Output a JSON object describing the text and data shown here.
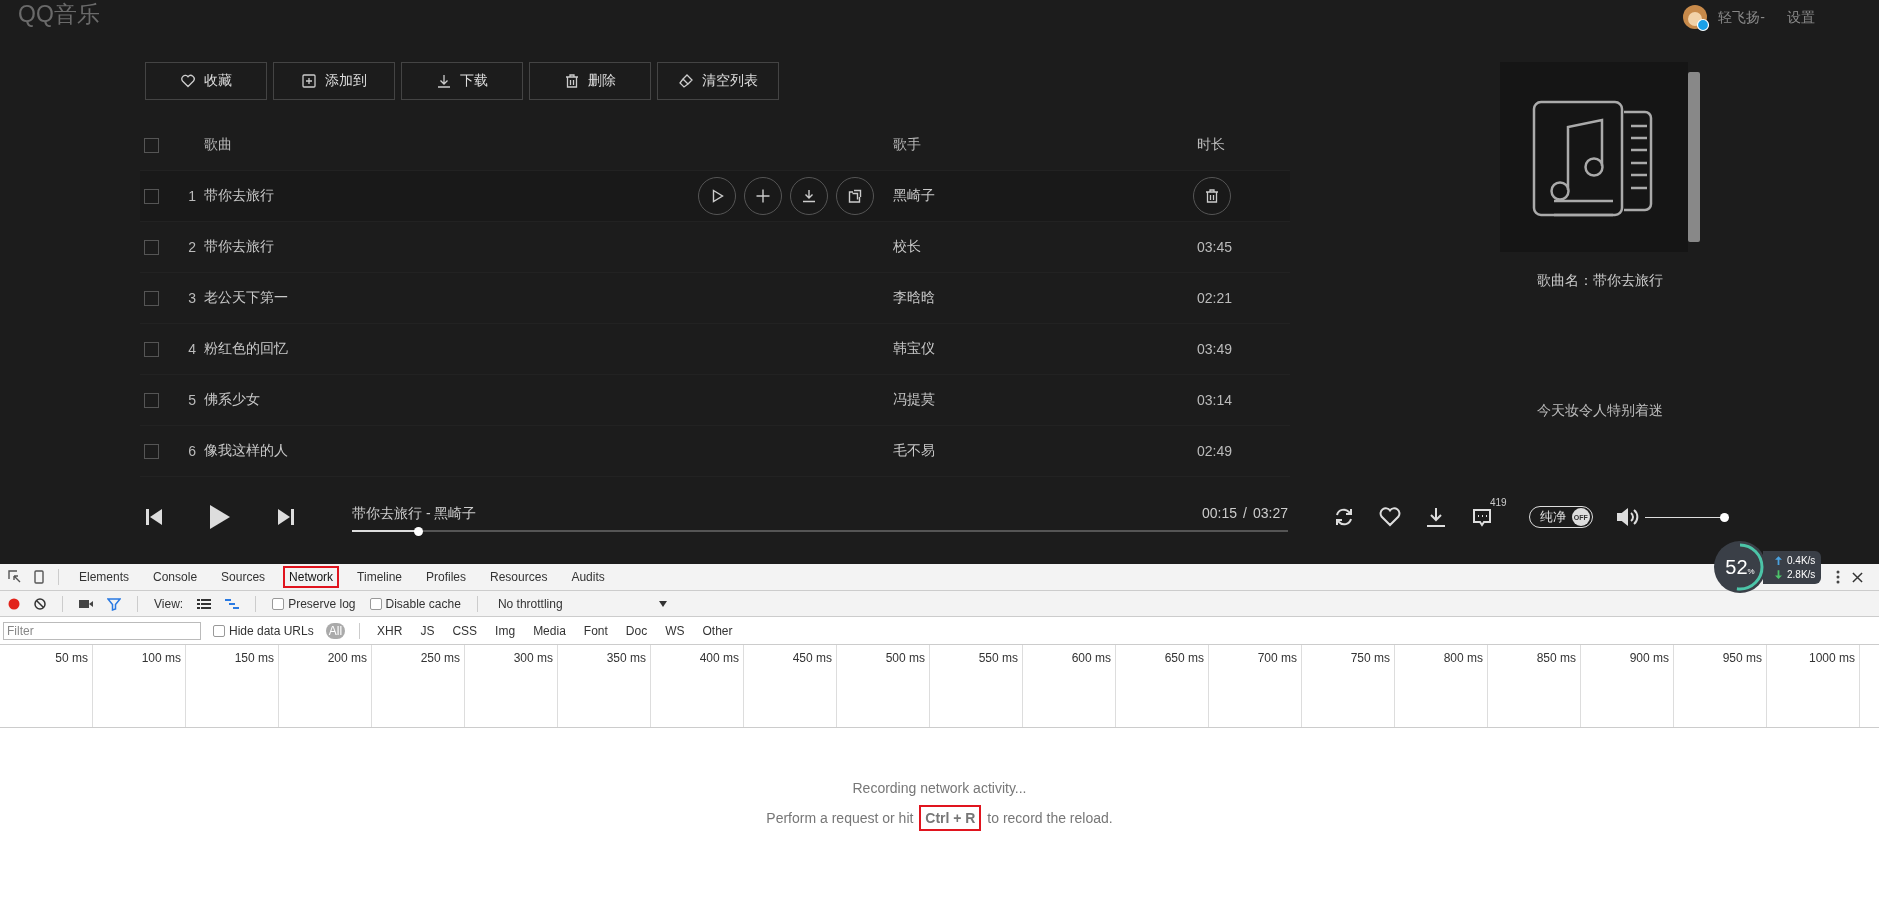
{
  "app": {
    "logo": "QQ音乐",
    "user": {
      "name": "轻飞扬-",
      "settings": "设置"
    },
    "toolbar": [
      {
        "label": "收藏"
      },
      {
        "label": "添加到"
      },
      {
        "label": "下载"
      },
      {
        "label": "删除"
      },
      {
        "label": "清空列表"
      }
    ],
    "song_table": {
      "columns": [
        "歌曲",
        "歌手",
        "时长"
      ],
      "select_all_checked": false,
      "rows": [
        {
          "number": "1",
          "title": "带你去旅行",
          "singer": "黑崎子",
          "hovered": true,
          "checked": false
        },
        {
          "number": "2",
          "title": "带你去旅行",
          "singer": "校长",
          "duration": "03:45",
          "hovered": false,
          "checked": false
        },
        {
          "number": "3",
          "title": "老公天下第一",
          "singer": "李晗晗",
          "duration": "02:21",
          "hovered": false,
          "checked": false
        },
        {
          "number": "4",
          "title": "粉红色的回忆",
          "singer": "韩宝仪",
          "duration": "03:49",
          "hovered": false,
          "checked": false
        },
        {
          "number": "5",
          "title": "佛系少女",
          "singer": "冯提莫",
          "duration": "03:14",
          "hovered": false,
          "checked": false
        },
        {
          "number": "6",
          "title": "像我这样的人",
          "singer": "毛不易",
          "duration": "02:49",
          "hovered": false,
          "checked": false
        }
      ]
    },
    "now_playing": {
      "song_name": "歌曲名：带你去旅行",
      "lyric": "今天妆令人特别着迷"
    },
    "player": {
      "track": "带你去旅行 - 黑崎子",
      "elapsed": "00:15",
      "separator": "/",
      "total": "03:27",
      "progress": {
        "level": 0.07
      },
      "comment_count": "419",
      "purity_toggle": {
        "label": "纯净",
        "knob": "OFF",
        "on": false
      },
      "volume": {
        "level": 1.0
      }
    }
  },
  "speed_widget": {
    "percent": "52",
    "unit": "%",
    "level": 0.52,
    "upload": "0.4K/s",
    "download": "2.8K/s"
  },
  "devtools": {
    "tabs": [
      {
        "label": "Elements",
        "selected": false,
        "highlighted": false
      },
      {
        "label": "Console",
        "selected": false,
        "highlighted": false
      },
      {
        "label": "Sources",
        "selected": false,
        "highlighted": false
      },
      {
        "label": "Network",
        "selected": true,
        "highlighted": true
      },
      {
        "label": "Timeline",
        "selected": false,
        "highlighted": false
      },
      {
        "label": "Profiles",
        "selected": false,
        "highlighted": false
      },
      {
        "label": "Resources",
        "selected": false,
        "highlighted": false
      },
      {
        "label": "Audits",
        "selected": false,
        "highlighted": false
      }
    ],
    "toolbar": {
      "recording": true,
      "filter_on": true,
      "view_label": "View:",
      "options": [
        {
          "label": "Preserve log",
          "checked": false
        },
        {
          "label": "Disable cache",
          "checked": false
        }
      ],
      "throttling": "No throttling"
    },
    "filter": {
      "placeholder": "Filter",
      "hide_data_urls": {
        "label": "Hide data URLs",
        "checked": false
      },
      "types": [
        {
          "label": "All",
          "selected": true
        },
        {
          "label": "XHR",
          "selected": false
        },
        {
          "label": "JS",
          "selected": false
        },
        {
          "label": "CSS",
          "selected": false
        },
        {
          "label": "Img",
          "selected": false
        },
        {
          "label": "Media",
          "selected": false
        },
        {
          "label": "Font",
          "selected": false
        },
        {
          "label": "Doc",
          "selected": false
        },
        {
          "label": "WS",
          "selected": false
        },
        {
          "label": "Other",
          "selected": false
        }
      ]
    },
    "timeline": {
      "ticks": [
        "50 ms",
        "100 ms",
        "150 ms",
        "200 ms",
        "250 ms",
        "300 ms",
        "350 ms",
        "400 ms",
        "450 ms",
        "500 ms",
        "550 ms",
        "600 ms",
        "650 ms",
        "700 ms",
        "750 ms",
        "800 ms",
        "850 ms",
        "900 ms",
        "950 ms",
        "1000 ms"
      ]
    },
    "message": {
      "title": "Recording network activity...",
      "hint": "Perform a request or hit **Ctrl + R** to record the reload.",
      "hint_highlighted": true
    }
  }
}
